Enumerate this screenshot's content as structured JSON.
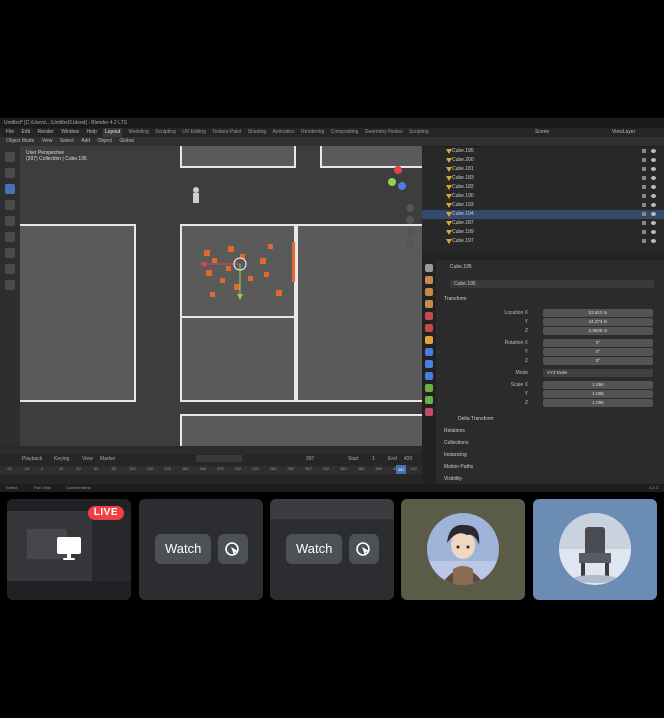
{
  "blender": {
    "title": "Untitled* [C:\\Users\\...\\Untitled3.blend] - Blender 4.2 LTS",
    "menu": [
      "File",
      "Edit",
      "Render",
      "Window",
      "Help"
    ],
    "workspaces": [
      "Layout",
      "Modeling",
      "Sculpting",
      "UV Editing",
      "Texture Paint",
      "Shading",
      "Animation",
      "Rendering",
      "Compositing",
      "Geometry Nodes",
      "Scripting"
    ],
    "active_workspace": "Layout",
    "scene_label": "Scene",
    "viewlayer_label": "ViewLayer",
    "viewport_header": [
      "Object Mode",
      "View",
      "Select",
      "Add",
      "Object",
      "Global"
    ],
    "viewport_info_1": "User Perspective",
    "viewport_info_2": "(397) Collection | Cube.195",
    "outliner_items": [
      "Cube.195",
      "Cube.200",
      "Cube.181",
      "Cube.183",
      "Cube.182",
      "Cube.190",
      "Cube.193",
      "Cube.194",
      "Cube.187",
      "Cube.199",
      "Cube.197"
    ],
    "outliner_selected_index": 7,
    "props_object": "Cube.195",
    "props_object_data": "Cube.195",
    "transform_label": "Transform",
    "location_label": "Location X",
    "location": [
      "53.913 m",
      "24.274 m",
      "2.9848 m"
    ],
    "rotation_label": "Rotation X",
    "rotation": [
      "0°",
      "0°",
      "0°"
    ],
    "mode_label": "Mode",
    "mode_value": "XYZ Euler",
    "scale_label": "Scale X",
    "scale": [
      "1.096",
      "1.096",
      "1.096"
    ],
    "y_label": "Y",
    "z_label": "Z",
    "sections": [
      "Delta Transform",
      "Relations",
      "Collections",
      "Instancing",
      "Motion Paths",
      "Visibility"
    ],
    "timeline_menu": [
      "Playback",
      "Keying",
      "View",
      "Marker"
    ],
    "timeline_ticks": [
      "-20",
      "-10",
      "0",
      "20",
      "40",
      "60",
      "80",
      "100",
      "120",
      "140",
      "160",
      "180",
      "200",
      "220",
      "240",
      "260",
      "280",
      "300",
      "320",
      "340",
      "360",
      "380",
      "400",
      "420"
    ],
    "current_frame": "397",
    "start_label": "Start",
    "start_value": "1",
    "end_label": "End",
    "end_value": "420",
    "status_left": "Select",
    "status_mid": "Pan View",
    "status_right": "Context Menu",
    "status_version": "4.2.3"
  },
  "tiles": {
    "live_badge": "LIVE",
    "watch_label_1": "Watch",
    "watch_label_2": "Watch"
  },
  "colors": {
    "live_red": "#ed4245",
    "button_gray": "#4e5058",
    "blender_selection_blue": "#4772b3"
  }
}
